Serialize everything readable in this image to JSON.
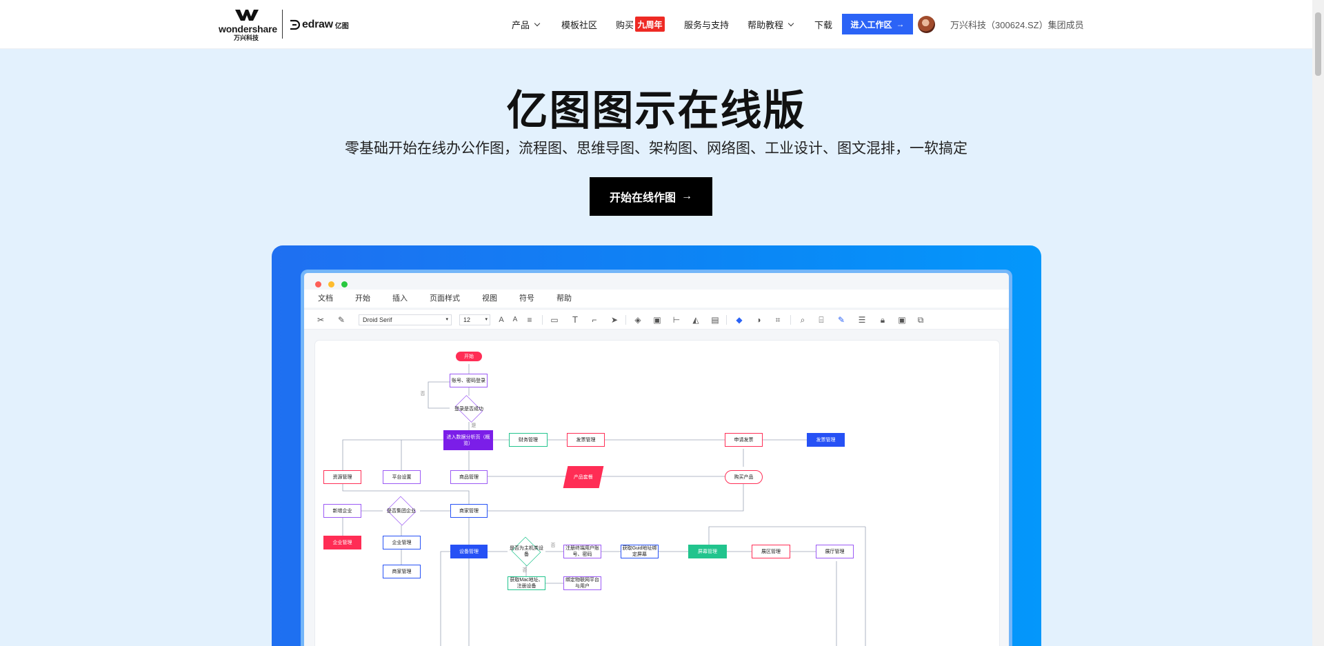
{
  "header": {
    "brand_wondershare": "wondershare",
    "brand_wondershare_cn": "万兴科技",
    "brand_edraw": "edraw",
    "brand_edraw_cn": "亿图",
    "nav": [
      {
        "label": "产品",
        "dropdown": true
      },
      {
        "label": "模板社区",
        "dropdown": false
      },
      {
        "label": "购买",
        "dropdown": false
      },
      {
        "label": "服务与支持",
        "dropdown": false
      },
      {
        "label": "帮助教程",
        "dropdown": true
      },
      {
        "label": "下载",
        "dropdown": false
      }
    ],
    "anniversary_badge": "九周年",
    "enter_workspace": "进入工作区",
    "member_text": "万兴科技（300624.SZ）集团成员"
  },
  "hero": {
    "title": "亿图图示在线版",
    "subtitle": "零基础开始在线办公作图，流程图、思维导图、架构图、网络图、工业设计、图文混排，一软搞定",
    "cta": "开始在线作图"
  },
  "app_preview": {
    "menu": [
      "文档",
      "开始",
      "插入",
      "页面样式",
      "视图",
      "符号",
      "帮助"
    ],
    "font_name": "Droid Serif",
    "font_size": "12",
    "flow_nodes": {
      "start": "开始",
      "login": "账号、密码登录",
      "login_ok": "登录是否成功",
      "no": "否",
      "yes": "是",
      "dashboard": "进入数据分析页（概览）",
      "finance": "财务管理",
      "invoice": "发票管理",
      "apply_invoice": "申请发票",
      "invoice_manage": "发票管理",
      "resource": "资源管理",
      "platform": "平台设置",
      "goods": "商品管理",
      "product_price": "产品套餐",
      "buy_product": "购买产品",
      "new_company": "新增企业",
      "is_group": "是否集团企业",
      "merchant": "商家管理",
      "company_mgmt": "企业管理",
      "company_mgmt2": "企业管理",
      "shop_mgmt": "商家管理",
      "device": "设备管理",
      "is_host": "是否为主机类设备",
      "register_user": "注册终端用户账号、密码",
      "guid": "获取Guid地址绑定屏幕",
      "screen": "屏幕管理",
      "area": "展区管理",
      "hall": "展厅管理",
      "mac": "获取Mac地址、注册设备",
      "bind": "绑定物联网平台与用户",
      "no2": "否",
      "no3": "否"
    }
  },
  "colors": {
    "accent_blue": "#2b63f6",
    "badge_red": "#ee2a24",
    "pink": "#ff2d55",
    "purple": "#7b1ee8",
    "teal": "#21c48d",
    "flow_blue": "#2651f5"
  }
}
